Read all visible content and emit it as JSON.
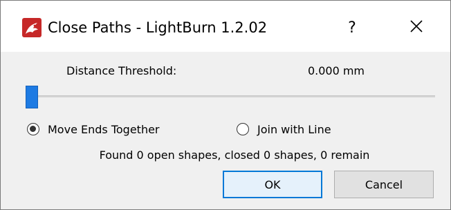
{
  "window": {
    "title": "Close Paths - LightBurn 1.2.02",
    "help_label": "?",
    "close_label": "×"
  },
  "threshold": {
    "label": "Distance Threshold:",
    "value_text": "0.000 mm",
    "slider_level": 0
  },
  "options": {
    "move_ends": {
      "label": "Move Ends Together",
      "selected": true
    },
    "join_line": {
      "label": "Join with Line",
      "selected": false
    }
  },
  "status_text": "Found 0 open shapes, closed 0 shapes, 0 remain",
  "buttons": {
    "ok": "OK",
    "cancel": "Cancel"
  },
  "colors": {
    "accent": "#1e7be3",
    "icon_bg": "#c62828",
    "default_button_border": "#0078d7"
  },
  "icons": {
    "app": "lightburn-dragon-icon",
    "close": "close-icon"
  }
}
